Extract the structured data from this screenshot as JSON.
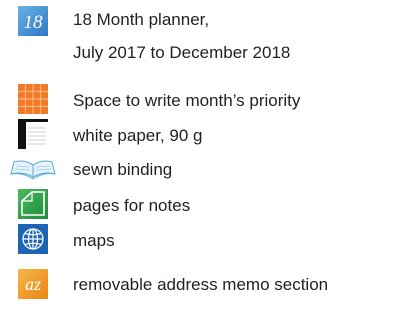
{
  "features": {
    "planner": {
      "icon": "calendar-18-icon",
      "icon_number": "18",
      "title": "18 Month planner,",
      "subtitle": "July 2017 to December 2018",
      "color": "#4a90d0"
    },
    "priority": {
      "icon": "grid-icon",
      "label": "Space to write month’s priority",
      "color": "#f07a28"
    },
    "paper": {
      "icon": "paper-stack-icon",
      "label": "white paper, 90 g",
      "color": "#111111"
    },
    "binding": {
      "icon": "open-book-icon",
      "label": "sewn binding",
      "color": "#5aa8d6"
    },
    "notes": {
      "icon": "note-page-icon",
      "label": "pages for notes",
      "color": "#2e9b4a"
    },
    "maps": {
      "icon": "globe-icon",
      "label": "maps",
      "color": "#1e64b4"
    },
    "address": {
      "icon": "az-icon",
      "icon_text": "az",
      "label": "removable address memo section",
      "color": "#f39a20"
    }
  }
}
